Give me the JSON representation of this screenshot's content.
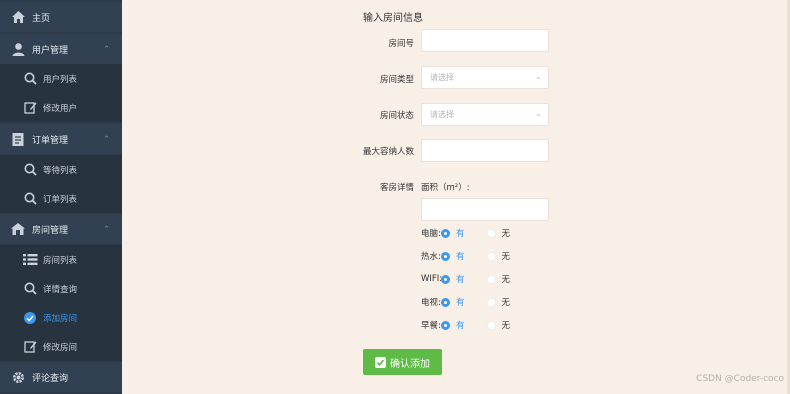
{
  "sidebar": {
    "home": "主页",
    "groups": [
      {
        "label": "用户管理",
        "icon": "user-icon",
        "items": [
          {
            "label": "用户列表",
            "icon": "search-icon"
          },
          {
            "label": "修改用户",
            "icon": "edit-icon"
          }
        ]
      },
      {
        "label": "订单管理",
        "icon": "document-icon",
        "items": [
          {
            "label": "等待列表",
            "icon": "search-icon"
          },
          {
            "label": "订单列表",
            "icon": "search-icon"
          }
        ]
      },
      {
        "label": "房间管理",
        "icon": "house-icon",
        "items": [
          {
            "label": "房间列表",
            "icon": "list-icon"
          },
          {
            "label": "详情查询",
            "icon": "search-icon"
          },
          {
            "label": "添加房间",
            "icon": "add-icon",
            "active": true
          },
          {
            "label": "修改房间",
            "icon": "edit-icon"
          }
        ]
      }
    ],
    "reviews": "评论查询",
    "active_color": "#3a98f0"
  },
  "form": {
    "title": "输入房间信息",
    "room_no_label": "房间号",
    "room_type_label": "房间类型",
    "room_type_placeholder": "请选择",
    "room_status_label": "房间状态",
    "room_status_placeholder": "请选择",
    "max_capacity_label": "最大容纳人数",
    "details_label": "客房详情",
    "area_label": "面积（m²）:",
    "options": [
      {
        "label": "电脑:",
        "yes": "有",
        "no": "无"
      },
      {
        "label": "热水:",
        "yes": "有",
        "no": "无"
      },
      {
        "label": "WIFI:",
        "yes": "有",
        "no": "无"
      },
      {
        "label": "电视:",
        "yes": "有",
        "no": "无"
      },
      {
        "label": "早餐:",
        "yes": "有",
        "no": "无"
      }
    ],
    "submit": "确认添加",
    "submit_color": "#5dbb46"
  },
  "watermark": "CSDN @Coder-coco"
}
